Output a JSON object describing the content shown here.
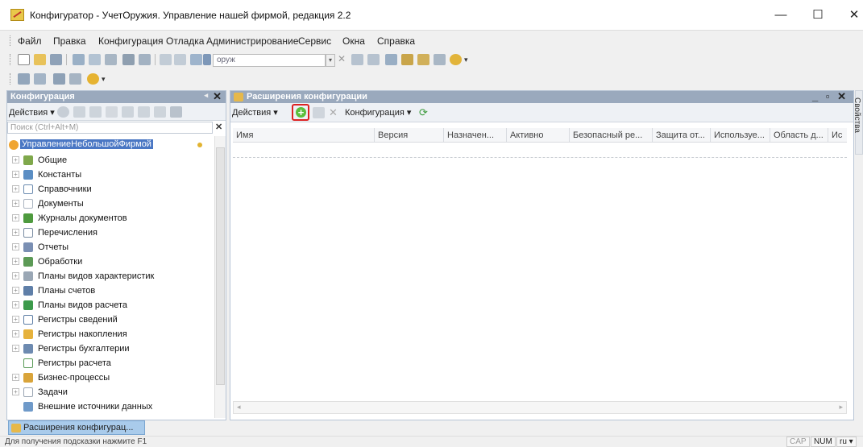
{
  "window": {
    "title": "Конфигуратор - УчетОружия. Управление нашей фирмой, редакция 2.2",
    "minimize": "—",
    "maximize": "☐",
    "close": "✕"
  },
  "menu": [
    "Файл",
    "Правка",
    "Конфигурация",
    "Отладка",
    "Администрирование",
    "Сервис",
    "Окна",
    "Справка"
  ],
  "search": {
    "value": "оруж"
  },
  "left_panel": {
    "title": "Конфигурация",
    "actions_label": "Действия ▾",
    "search_placeholder": "Поиск (Ctrl+Alt+M)",
    "root": "УправлениеНебольшойФирмой",
    "items": [
      "Общие",
      "Константы",
      "Справочники",
      "Документы",
      "Журналы документов",
      "Перечисления",
      "Отчеты",
      "Обработки",
      "Планы видов характеристик",
      "Планы счетов",
      "Планы видов расчета",
      "Регистры сведений",
      "Регистры накопления",
      "Регистры бухгалтерии",
      "Регистры расчета",
      "Бизнес-процессы",
      "Задачи",
      "Внешние источники данных"
    ]
  },
  "right_panel": {
    "title": "Расширения конфигурации",
    "actions_label": "Действия ▾",
    "config_label": "Конфигурация ▾",
    "columns": [
      "Имя",
      "Версия",
      "Назначен...",
      "Активно",
      "Безопасный ре...",
      "Защита от...",
      "Используе...",
      "Область д...",
      "Ис"
    ]
  },
  "side_tab": "Свойства",
  "taskbar": {
    "tab": "Расширения конфигурац..."
  },
  "status": {
    "text": "Для получения подсказки нажмите F1",
    "cap": "CAP",
    "num": "NUM",
    "lang": "ru ▾"
  },
  "colors": {
    "header": "#9aa9bd",
    "selection": "#4a77c4",
    "add_highlight": "#dd2222",
    "add_icon": "#5cbf3c"
  }
}
